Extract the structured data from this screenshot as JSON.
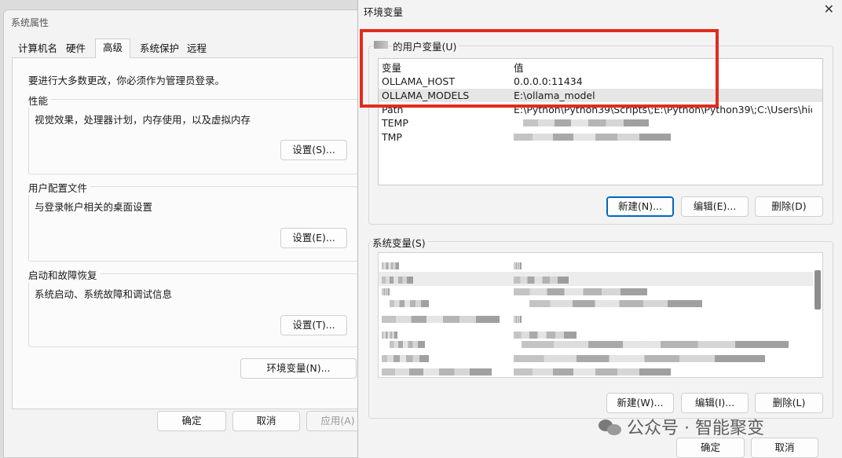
{
  "system_properties": {
    "title": "系统属性",
    "tabs": [
      "计算机名",
      "硬件",
      "高级",
      "系统保护",
      "远程"
    ],
    "admin_note": "要进行大多数更改，你必须作为管理员登录。",
    "performance": {
      "label": "性能",
      "desc": "视觉效果，处理器计划，内存使用，以及虚拟内存",
      "button": "设置(S)..."
    },
    "user_profiles": {
      "label": "用户配置文件",
      "desc": "与登录帐户相关的桌面设置",
      "button": "设置(E)..."
    },
    "startup_recovery": {
      "label": "启动和故障恢复",
      "desc": "系统启动、系统故障和调试信息",
      "button": "设置(T)..."
    },
    "env_button": "环境变量(N)...",
    "ok": "确定",
    "cancel": "取消",
    "apply": "应用(A)"
  },
  "env_vars": {
    "title": "环境变量",
    "close": "✕",
    "user_section_label": "的用户变量(U)",
    "header_var": "变量",
    "header_value": "值",
    "user_rows": [
      {
        "name": "OLLAMA_HOST",
        "value": "0.0.0.0:11434"
      },
      {
        "name": "OLLAMA_MODELS",
        "value": "E:\\ollama_model"
      },
      {
        "name": "Path",
        "value": "E:\\Python\\Python39\\Scripts\\;E:\\Python\\Python39\\;C:\\Users\\hid..."
      },
      {
        "name": "TEMP",
        "value": ""
      },
      {
        "name": "TMP",
        "value": ""
      }
    ],
    "user_buttons": {
      "new": "新建(N)...",
      "edit": "编辑(E)...",
      "delete": "删除(D)"
    },
    "system_section_label": "系统变量(S)",
    "system_buttons": {
      "new": "新建(W)...",
      "edit": "编辑(I)...",
      "delete": "删除(L)"
    },
    "ok": "确定",
    "cancel": "取消"
  },
  "watermark": "公众号 · 智能聚变",
  "colors": {
    "highlight": "#e12c1e",
    "accent": "#0067c0"
  }
}
